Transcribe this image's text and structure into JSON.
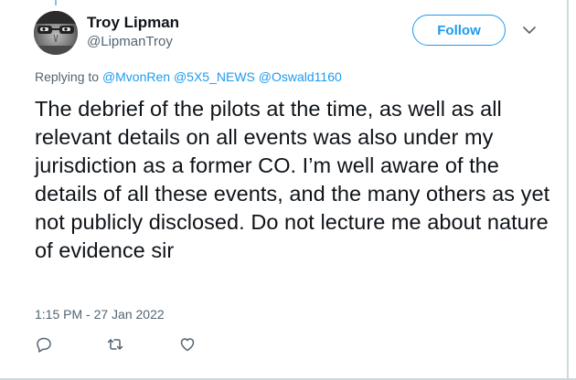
{
  "tweet": {
    "author_name": "Troy Lipman",
    "author_handle": "@LipmanTroy",
    "follow_label": "Follow",
    "replying_prefix": "Replying to",
    "mentions": [
      "@MvonRen",
      "@5X5_NEWS",
      "@Oswald1160"
    ],
    "body": "The debrief of the pilots at the time, as well as all relevant details on all events was also under my jurisdiction as a former CO. I’m well aware of the details of all these events, and the many others as yet not publicly disclosed. Do not lecture me about nature of evidence sir",
    "timestamp": "1:15 PM - 27 Jan 2022"
  },
  "icons": {
    "reply": "reply-icon",
    "retweet": "retweet-icon",
    "like": "like-icon",
    "more": "chevron-down-icon"
  },
  "colors": {
    "accent": "#1d9bf0",
    "secondary_text": "#536471",
    "primary_text": "#0f1419"
  }
}
